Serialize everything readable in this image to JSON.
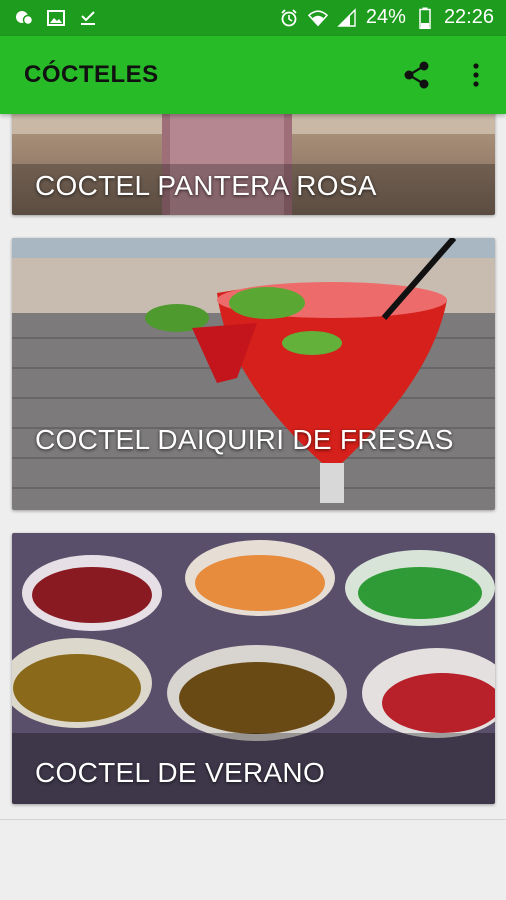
{
  "status_bar": {
    "icons": [
      "chat-bubble-icon",
      "image-icon",
      "download-done-icon",
      "alarm-icon",
      "wifi-icon",
      "signal-icon",
      "battery-icon"
    ],
    "battery": "24%",
    "time": "22:26"
  },
  "app_bar": {
    "title": "CÓCTELES",
    "actions": [
      "share-icon",
      "more-vert-icon"
    ],
    "color": "#27bb27"
  },
  "cards": [
    {
      "title": "COCTEL PANTERA ROSA"
    },
    {
      "title": "COCTEL DAIQUIRI DE FRESAS"
    },
    {
      "title": "COCTEL DE VERANO"
    }
  ]
}
